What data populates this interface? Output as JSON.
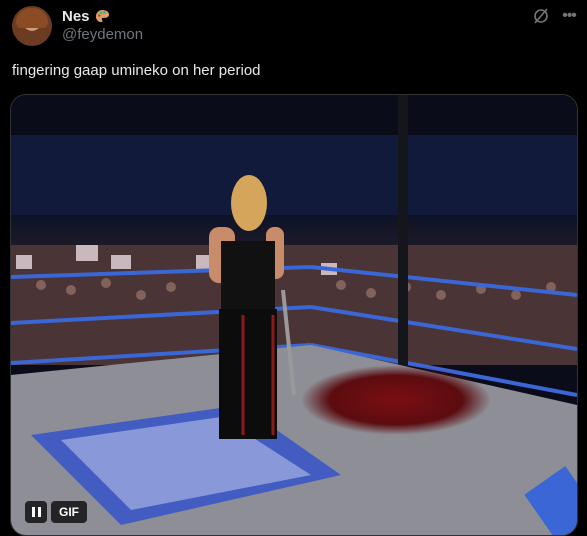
{
  "user": {
    "display_name": "Nes",
    "handle": "@feydemon",
    "badge_icon": "artist-palette-icon"
  },
  "header_icons": [
    "grok-icon",
    "more-icon"
  ],
  "tweet": {
    "text": "fingering gaap umineko on her period"
  },
  "media": {
    "type": "gif",
    "badge_label": "GIF",
    "state": "playing"
  },
  "colors": {
    "background": "#000000",
    "text_primary": "#e7e9ea",
    "text_secondary": "#71767b",
    "border": "#2f3336"
  }
}
